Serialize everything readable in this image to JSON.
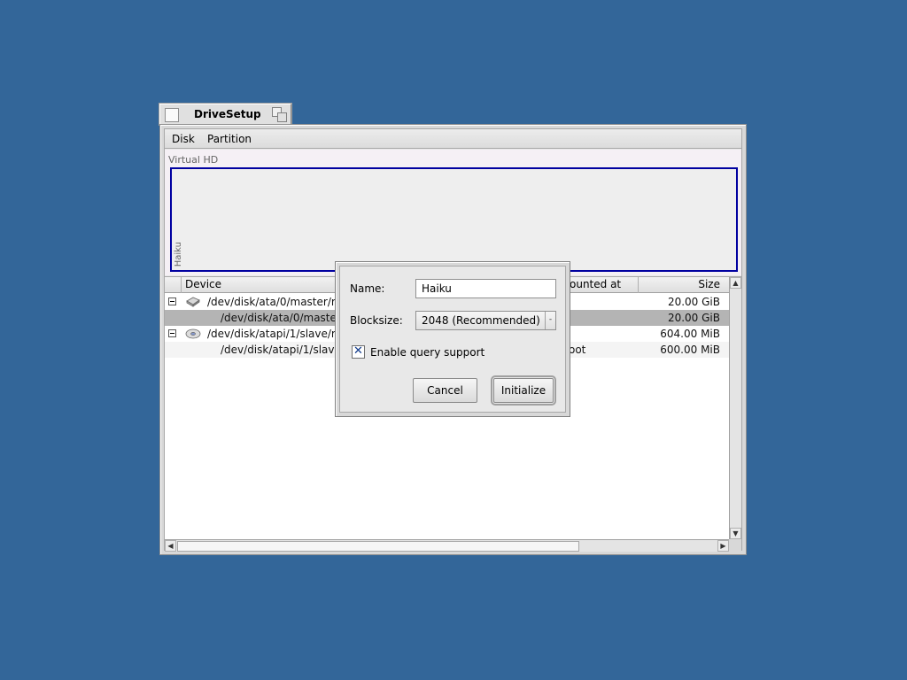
{
  "window": {
    "title": "DriveSetup",
    "menu": [
      "Disk",
      "Partition"
    ]
  },
  "disk_map": {
    "disk_label": "Virtual HD",
    "partition_label": "Haiku",
    "partition_border_color": "#0000a0"
  },
  "list": {
    "columns": [
      "Device",
      "ounted at",
      "Size"
    ],
    "rows": [
      {
        "device": "/dev/disk/ata/0/master/raw",
        "mounted": "",
        "size": "20.00 GiB",
        "icon": "hard-disk-icon",
        "expandable": true
      },
      {
        "device": "/dev/disk/ata/0/master/0",
        "mounted": "",
        "size": "20.00 GiB",
        "selected": true
      },
      {
        "device": "/dev/disk/atapi/1/slave/raw",
        "mounted": "",
        "size": "604.00 MiB",
        "icon": "cd-rom-icon",
        "expandable": true
      },
      {
        "device": "/dev/disk/atapi/1/slave/0",
        "mounted": "oot",
        "size": "600.00 MiB"
      }
    ]
  },
  "dialog": {
    "name_label": "Name:",
    "name_value": "Haiku",
    "blocksize_label": "Blocksize:",
    "blocksize_value": "2048 (Recommended)",
    "query_label": "Enable query support",
    "query_checked": true,
    "cancel_label": "Cancel",
    "initialize_label": "Initialize"
  },
  "colors": {
    "desktop": "#336699",
    "selection": "#b4b4b4"
  }
}
